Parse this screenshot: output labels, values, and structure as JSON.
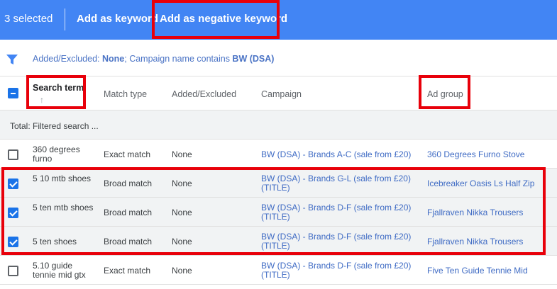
{
  "action_bar": {
    "selected_count": "3 selected",
    "add_keyword": "Add as keyword",
    "add_negative_keyword": "Add as negative keyword"
  },
  "filter": {
    "prefix": "Added/Excluded: ",
    "value1": "None",
    "middle": "; Campaign name contains ",
    "value2": "BW (DSA)"
  },
  "table": {
    "headers": {
      "search_term": "Search term",
      "sort_indicator": "↑",
      "match_type": "Match type",
      "added_excluded": "Added/Excluded",
      "campaign": "Campaign",
      "ad_group": "Ad group"
    },
    "total_label": "Total: Filtered search ...",
    "rows": [
      {
        "term": "360 degrees furno",
        "match": "Exact match",
        "added": "None",
        "campaign": "BW (DSA) - Brands A-C (sale from £20)",
        "ad_group": "360 Degrees Furno Stove",
        "checked": false
      },
      {
        "term": "5 10 mtb shoes",
        "match": "Broad match",
        "added": "None",
        "campaign": "BW (DSA) - Brands G-L (sale from £20) (TITLE)",
        "ad_group": "Icebreaker Oasis Ls Half Zip",
        "checked": true
      },
      {
        "term": "5 ten mtb shoes",
        "match": "Broad match",
        "added": "None",
        "campaign": "BW (DSA) - Brands D-F (sale from £20) (TITLE)",
        "ad_group": "Fjallraven Nikka Trousers",
        "checked": true
      },
      {
        "term": "5 ten shoes",
        "match": "Broad match",
        "added": "None",
        "campaign": "BW (DSA) - Brands D-F (sale from £20) (TITLE)",
        "ad_group": "Fjallraven Nikka Trousers",
        "checked": true
      },
      {
        "term": "5.10 guide tennie mid gtx",
        "match": "Exact match",
        "added": "None",
        "campaign": "BW (DSA) - Brands D-F (sale from £20) (TITLE)",
        "ad_group": "Five Ten Guide Tennie Mid",
        "checked": false
      }
    ]
  },
  "colors": {
    "action_bar": "#4285f4",
    "link": "#3f6bc4",
    "highlight": "#e8000a",
    "checkbox": "#1a73e8"
  },
  "icons": {
    "filter": "filter-icon",
    "sort": "arrow-up-icon"
  }
}
